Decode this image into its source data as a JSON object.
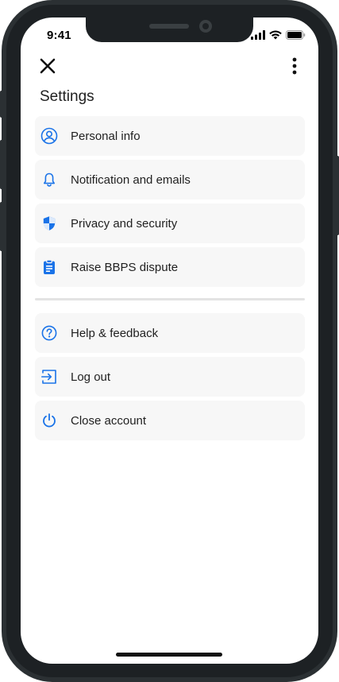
{
  "status_bar": {
    "time": "9:41"
  },
  "header": {
    "close_icon": "close-icon",
    "more_icon": "more-vertical-icon",
    "title": "Settings"
  },
  "menu_group_1": [
    {
      "label": "Personal info",
      "icon": "account-circle-icon"
    },
    {
      "label": "Notification and emails",
      "icon": "bell-icon"
    },
    {
      "label": "Privacy and security",
      "icon": "shield-icon"
    },
    {
      "label": "Raise BBPS dispute",
      "icon": "clipboard-icon"
    }
  ],
  "menu_group_2": [
    {
      "label": "Help & feedback",
      "icon": "help-circle-icon"
    },
    {
      "label": "Log out",
      "icon": "logout-icon"
    },
    {
      "label": "Close account",
      "icon": "power-icon"
    }
  ],
  "colors": {
    "accent": "#1a73e8",
    "item_background": "#f7f7f7",
    "text": "#1f1f1f"
  }
}
